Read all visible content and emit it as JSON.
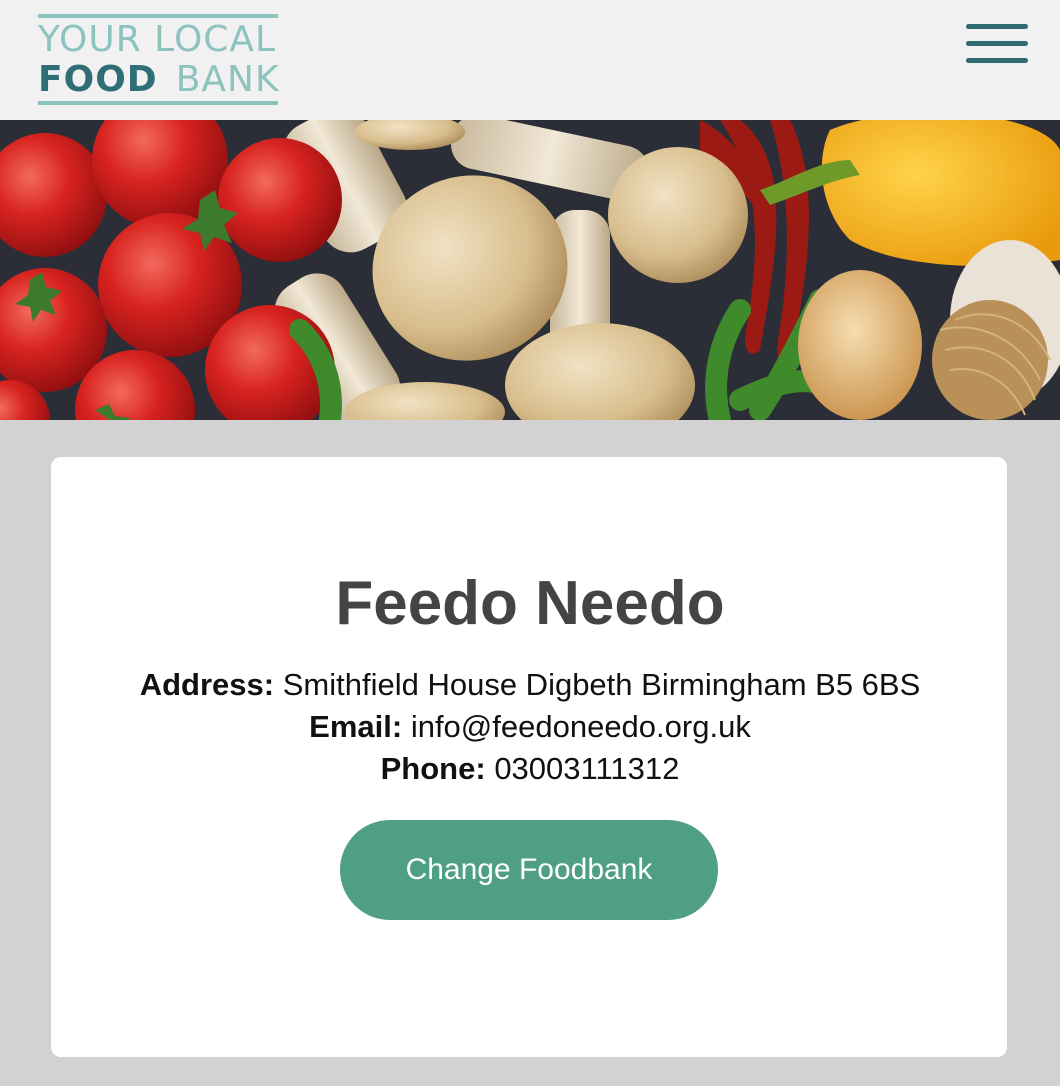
{
  "header": {
    "logo": {
      "line1": "YOUR LOCAL",
      "food": "FOOD",
      "bank": "BANK"
    },
    "menu_icon": "hamburger-menu-icon"
  },
  "hero": {
    "image": "vegetables-photo"
  },
  "foodbank": {
    "name": "Feedo Needo",
    "address_label": "Address:",
    "address": "Smithfield House Digbeth Birmingham B5 6BS",
    "email_label": "Email:",
    "email": "info@feedoneedo.org.uk",
    "phone_label": "Phone:",
    "phone": "03003111312"
  },
  "actions": {
    "change_label": "Change Foodbank"
  },
  "colors": {
    "header_bg": "#f1f1f1",
    "logo_light": "#8cc3bf",
    "logo_dark": "#2e6e74",
    "menu": "#2f6a70",
    "button": "#4f9e86",
    "page_bg": "#d2d2d2"
  }
}
